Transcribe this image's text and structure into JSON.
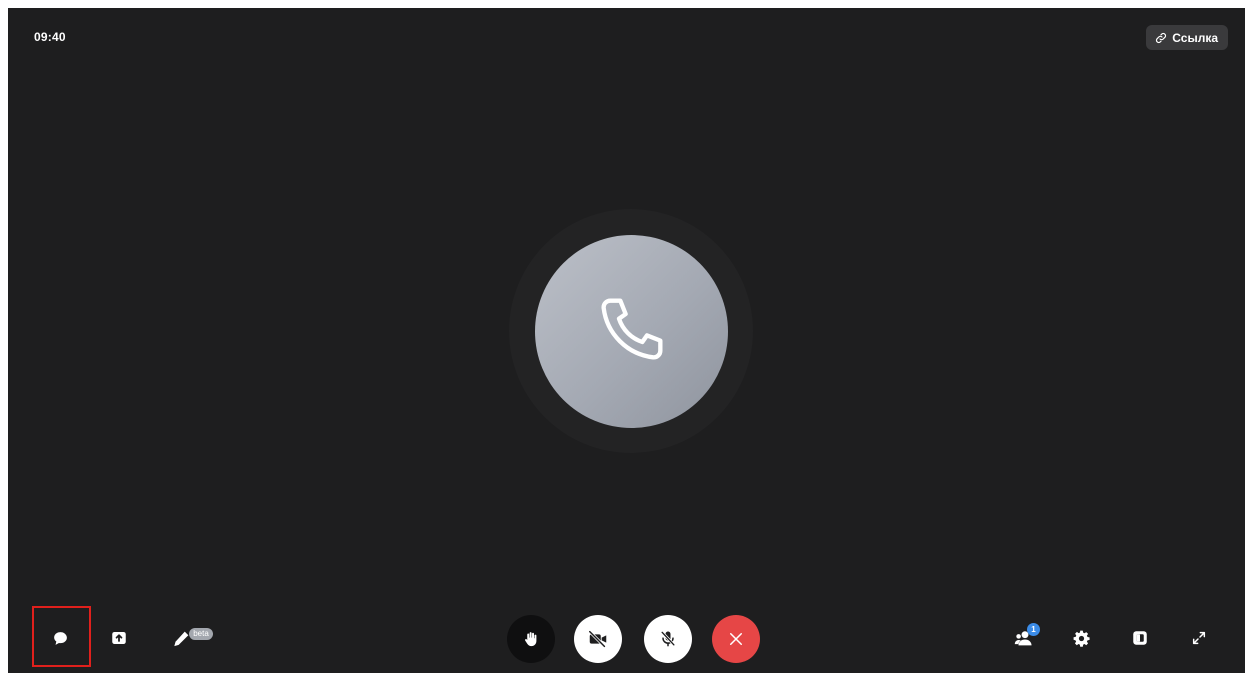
{
  "header": {
    "time": "09:40",
    "link_label": "Ссылка"
  },
  "call": {
    "avatar_icon": "phone-icon"
  },
  "toolbar_left": {
    "chat_icon": "chat-bubble-icon",
    "share_icon": "screen-share-icon",
    "draw_icon": "pencil-icon",
    "draw_badge": "beta"
  },
  "toolbar_center": {
    "hand_icon": "raise-hand-icon",
    "camera_icon": "camera-off-icon",
    "mic_icon": "mic-off-icon",
    "end_icon": "close-icon"
  },
  "toolbar_right": {
    "participants_icon": "participants-icon",
    "participants_badge": "1",
    "settings_icon": "gear-icon",
    "layout_icon": "layout-icon",
    "fullscreen_icon": "expand-icon"
  },
  "colors": {
    "background": "#1e1e1f",
    "end_call": "#e64646",
    "highlight": "#e0201c",
    "badge": "#3b8ce8"
  }
}
